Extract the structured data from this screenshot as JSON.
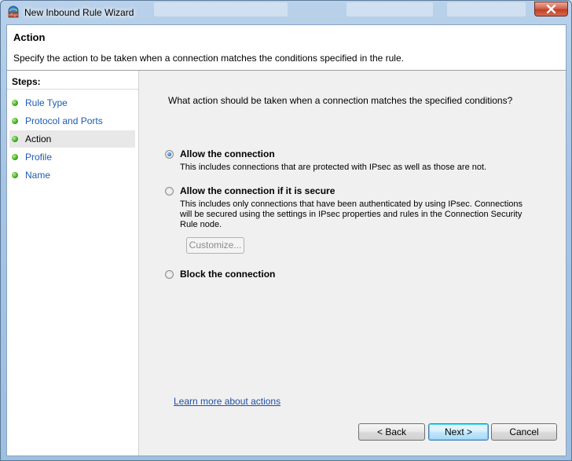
{
  "window": {
    "title": "New Inbound Rule Wizard",
    "icon": "firewall-wizard-icon",
    "close_icon": "close-icon"
  },
  "header": {
    "title": "Action",
    "description": "Specify the action to be taken when a connection matches the conditions specified in the rule."
  },
  "steps": {
    "heading": "Steps:",
    "items": [
      {
        "label": "Rule Type"
      },
      {
        "label": "Protocol and Ports"
      },
      {
        "label": "Action"
      },
      {
        "label": "Profile"
      },
      {
        "label": "Name"
      }
    ],
    "active": "Action"
  },
  "content": {
    "question": "What action should be taken when a connection matches the specified conditions?",
    "options": [
      {
        "label": "Allow the connection",
        "description": "This includes connections that are protected with IPsec as well as those are not.",
        "checked": true
      },
      {
        "label": "Allow the connection if it is secure",
        "description": "This includes only connections that have been authenticated by using IPsec.  Connections will be secured using the settings in IPsec properties and rules in the Connection Security Rule node.",
        "checked": false
      },
      {
        "label": "Block the connection",
        "description": "",
        "checked": false
      }
    ],
    "customize_label": "Customize...",
    "learn_more": "Learn more about actions"
  },
  "buttons": {
    "back": "< Back",
    "next": "Next >",
    "cancel": "Cancel"
  },
  "colors": {
    "link": "#1e50a2",
    "step_dot": "#3ea81e",
    "close_button": "#c23e25"
  }
}
